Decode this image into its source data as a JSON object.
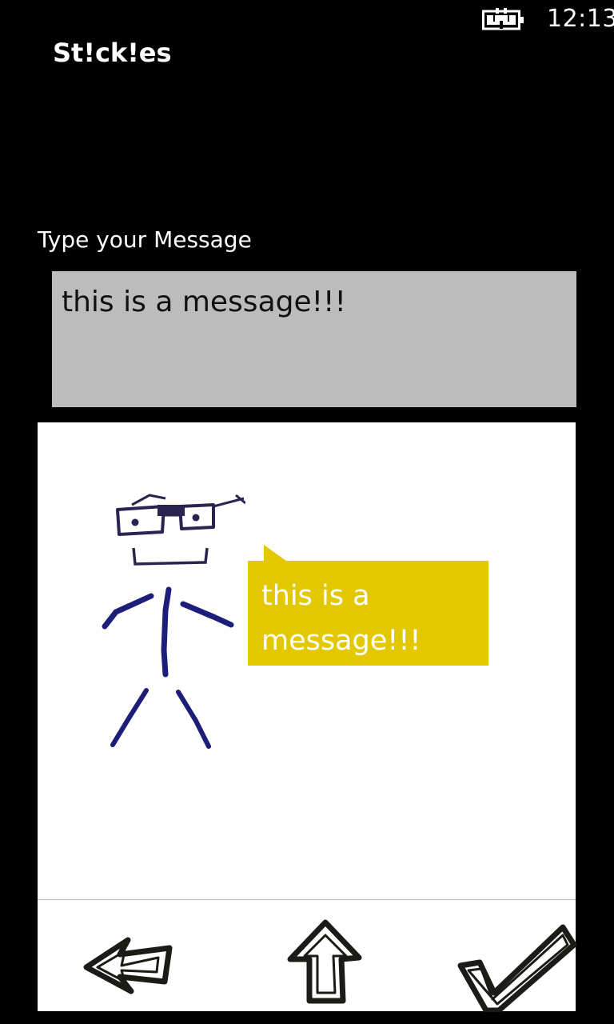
{
  "status_bar": {
    "battery_icon": "battery-charging-icon",
    "time": "12:13"
  },
  "app": {
    "title": "St!ck!es"
  },
  "message": {
    "label": "Type your Message",
    "value": "this is a message!!!"
  },
  "canvas": {
    "figure_icon": "stick-figure-with-glasses",
    "bubble_text": "this is a message!!!",
    "bubble_color": "#e3c800"
  },
  "toolbar": {
    "back_icon": "arrow-left-icon",
    "upload_icon": "arrow-up-icon",
    "accept_icon": "checkmark-icon"
  }
}
